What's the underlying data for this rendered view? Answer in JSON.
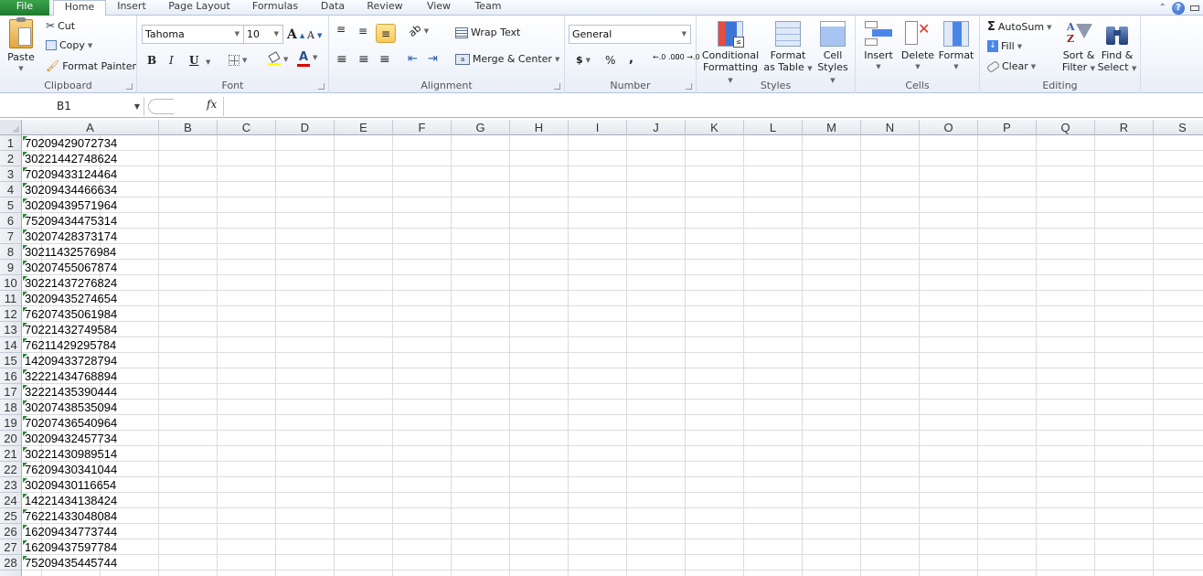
{
  "tabs": [
    {
      "label": "File",
      "id": "file"
    },
    {
      "label": "Home",
      "id": "home",
      "active": true
    },
    {
      "label": "Insert",
      "id": "insert"
    },
    {
      "label": "Page Layout",
      "id": "page-layout"
    },
    {
      "label": "Formulas",
      "id": "formulas"
    },
    {
      "label": "Data",
      "id": "data"
    },
    {
      "label": "Review",
      "id": "review"
    },
    {
      "label": "View",
      "id": "view"
    },
    {
      "label": "Team",
      "id": "team"
    }
  ],
  "window_controls": {
    "help": "?"
  },
  "ribbon": {
    "clipboard": {
      "label": "Clipboard",
      "paste": "Paste",
      "cut": "Cut",
      "copy": "Copy",
      "format_painter": "Format Painter"
    },
    "font": {
      "label": "Font",
      "font_name": "Tahoma",
      "font_size": "10",
      "bold": "B",
      "italic": "I",
      "underline": "U",
      "grow": "A",
      "shrink": "A",
      "font_color_glyph": "A",
      "fill_color": "#ffff00",
      "font_color": "#e00000"
    },
    "alignment": {
      "label": "Alignment",
      "wrap_text": "Wrap Text",
      "merge_center": "Merge & Center"
    },
    "number": {
      "label": "Number",
      "format": "General",
      "currency": "$",
      "percent": "%",
      "comma": ",",
      "inc_decimal": "←.0 .00",
      "dec_decimal": ".00 →.0"
    },
    "styles": {
      "label": "Styles",
      "conditional_formatting": [
        "Conditional",
        "Formatting"
      ],
      "format_as_table": [
        "Format",
        "as Table"
      ],
      "cell_styles": [
        "Cell",
        "Styles"
      ]
    },
    "cells": {
      "label": "Cells",
      "insert": "Insert",
      "delete": "Delete",
      "format": "Format"
    },
    "editing": {
      "label": "Editing",
      "autosum": "AutoSum",
      "fill": "Fill",
      "clear": "Clear",
      "sort_filter": [
        "Sort &",
        "Filter"
      ],
      "find_select": [
        "Find &",
        "Select"
      ]
    }
  },
  "formula_bar": {
    "name_box": "B1",
    "fx": "fx",
    "formula": ""
  },
  "sheet": {
    "columns": [
      "A",
      "B",
      "C",
      "D",
      "E",
      "F",
      "G",
      "H",
      "I",
      "J",
      "K",
      "L",
      "M",
      "N",
      "O",
      "P",
      "Q",
      "R",
      "S"
    ],
    "rows": [
      {
        "n": "1",
        "a": "70209429072734"
      },
      {
        "n": "2",
        "a": "30221442748624"
      },
      {
        "n": "3",
        "a": "70209433124464"
      },
      {
        "n": "4",
        "a": "30209434466634"
      },
      {
        "n": "5",
        "a": "30209439571964"
      },
      {
        "n": "6",
        "a": "75209434475314"
      },
      {
        "n": "7",
        "a": "30207428373174"
      },
      {
        "n": "8",
        "a": "30211432576984"
      },
      {
        "n": "9",
        "a": "30207455067874"
      },
      {
        "n": "10",
        "a": "30221437276824"
      },
      {
        "n": "11",
        "a": "30209435274654"
      },
      {
        "n": "12",
        "a": "76207435061984"
      },
      {
        "n": "13",
        "a": "70221432749584"
      },
      {
        "n": "14",
        "a": "76211429295784"
      },
      {
        "n": "15",
        "a": "14209433728794"
      },
      {
        "n": "16",
        "a": "32221434768894"
      },
      {
        "n": "17",
        "a": "32221435390444"
      },
      {
        "n": "18",
        "a": "30207438535094"
      },
      {
        "n": "19",
        "a": "70207436540964"
      },
      {
        "n": "20",
        "a": "30209432457734"
      },
      {
        "n": "21",
        "a": "30221430989514"
      },
      {
        "n": "22",
        "a": "76209430341044"
      },
      {
        "n": "23",
        "a": "30209430116654"
      },
      {
        "n": "24",
        "a": "14221434138424"
      },
      {
        "n": "25",
        "a": "76221433048084"
      },
      {
        "n": "26",
        "a": "16209434773744"
      },
      {
        "n": "27",
        "a": "16209437597784"
      },
      {
        "n": "28",
        "a": "75209435445744"
      }
    ]
  }
}
